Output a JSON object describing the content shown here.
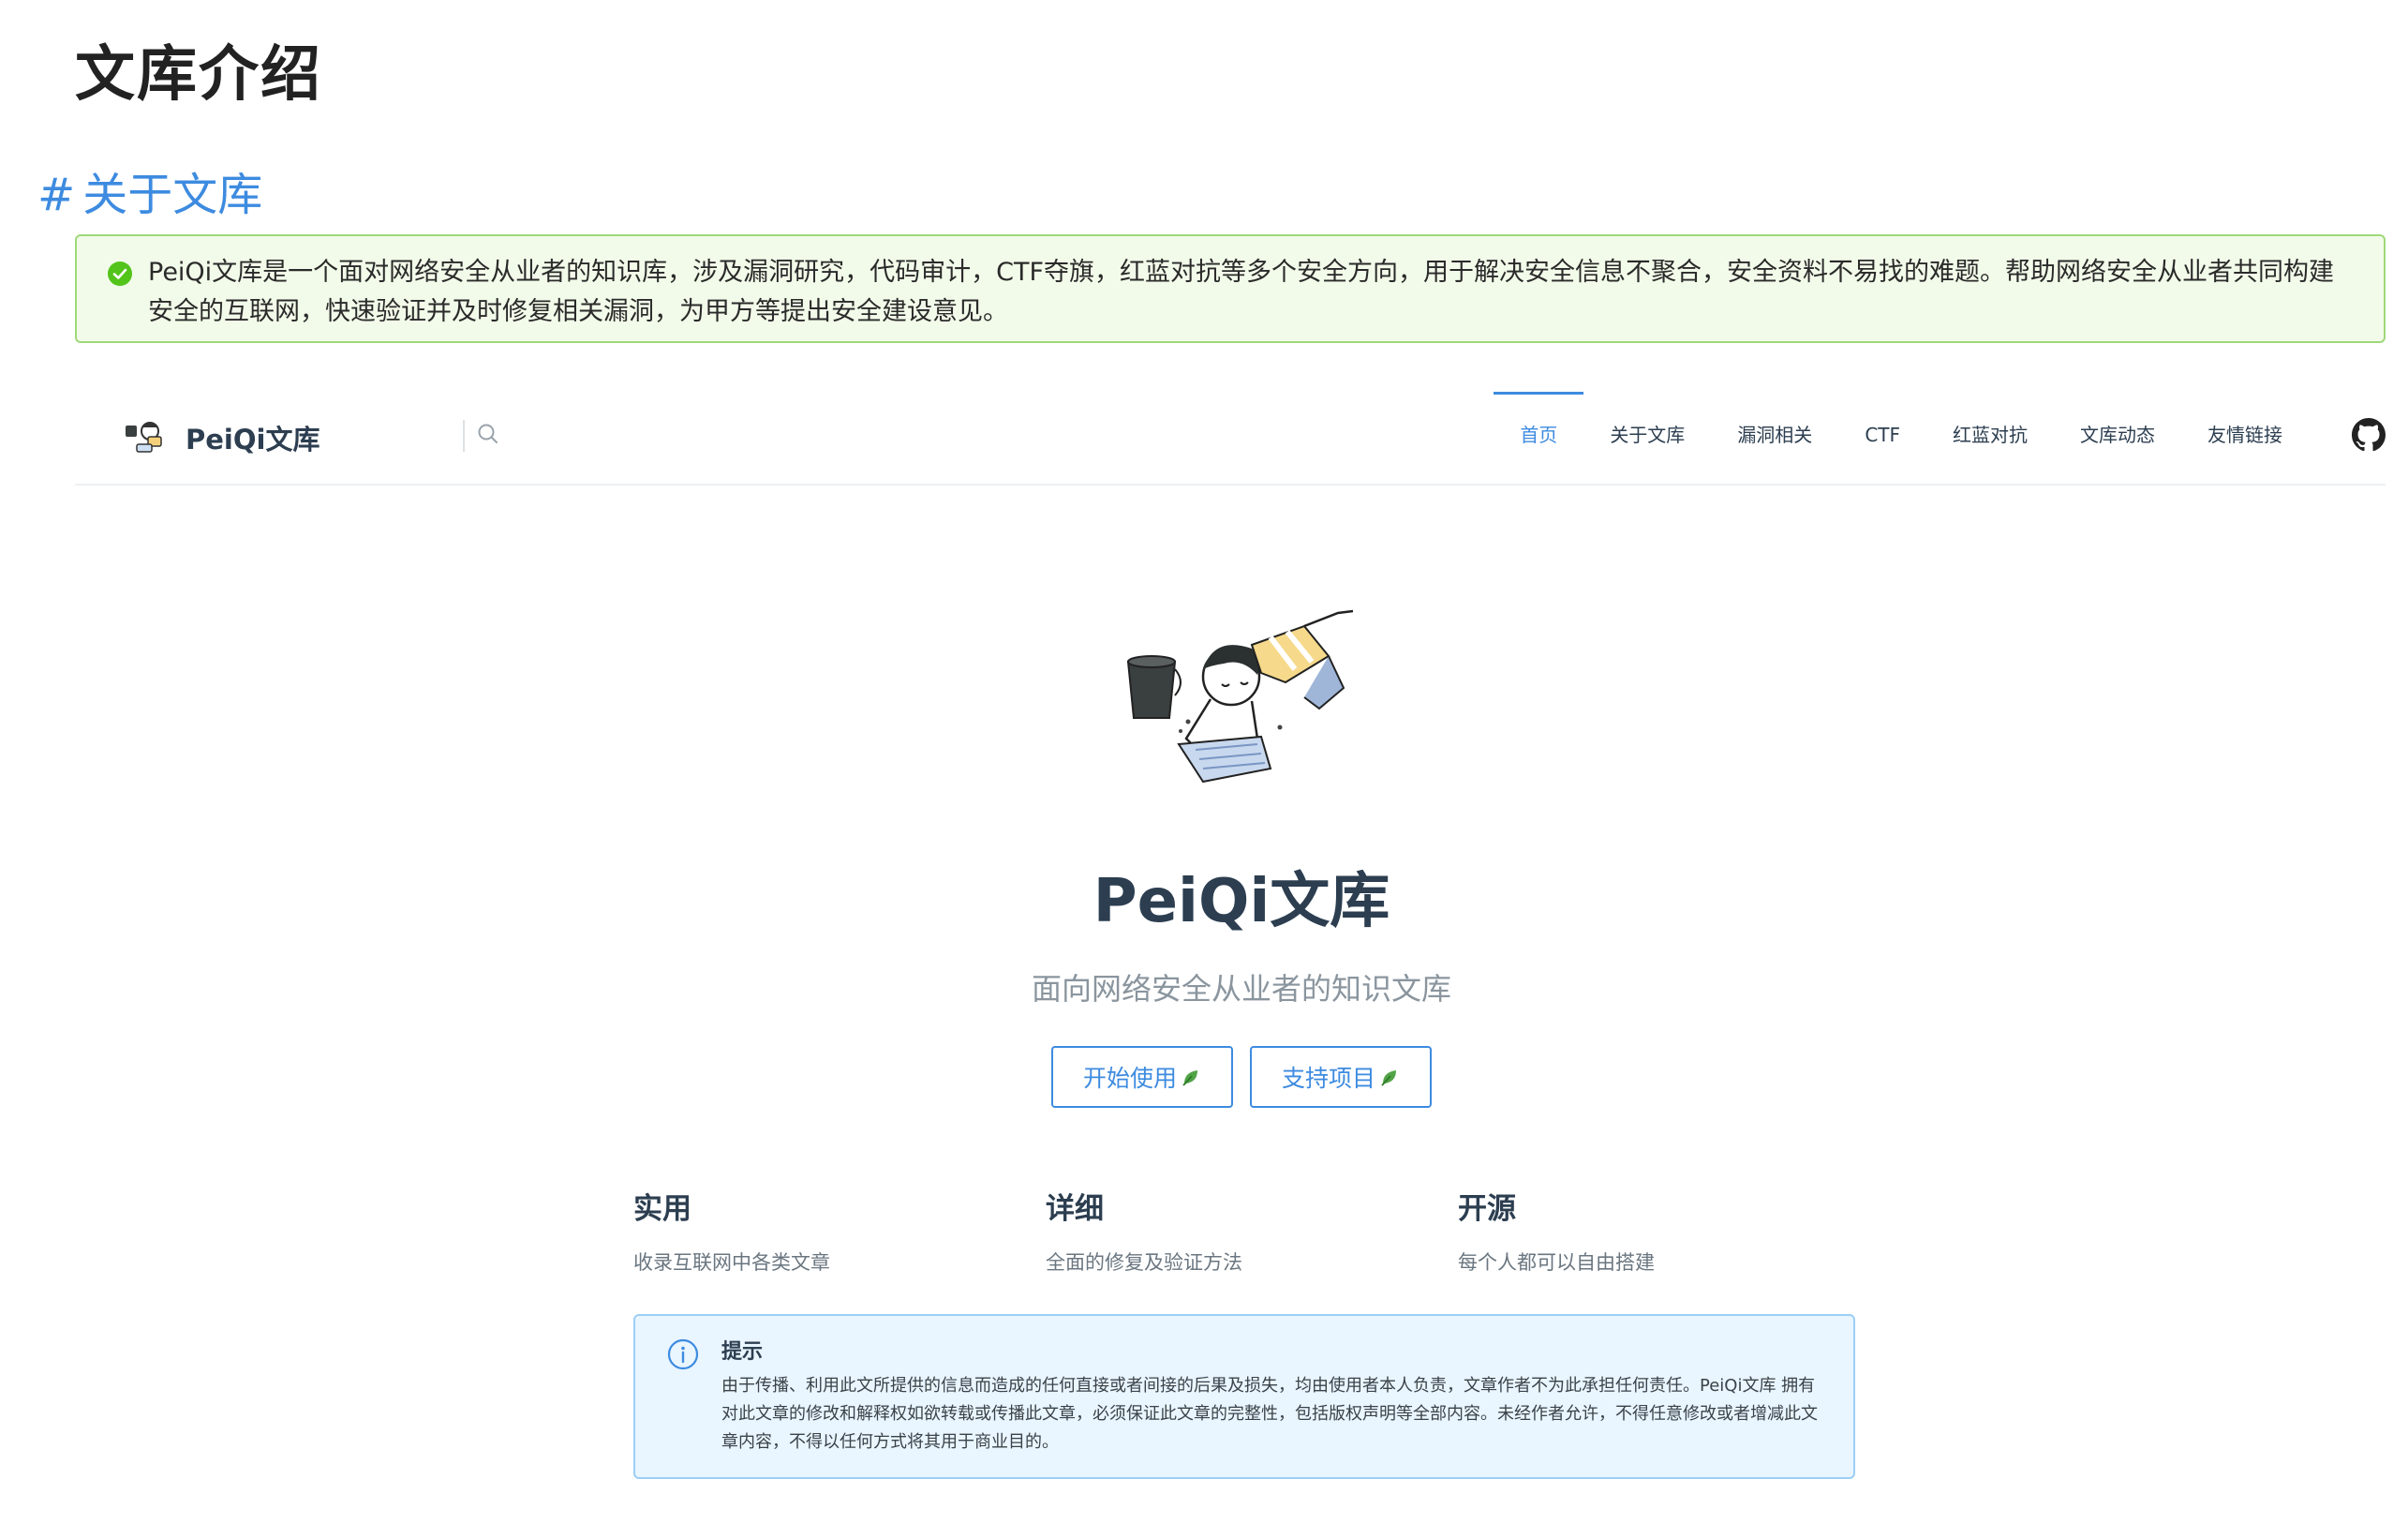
{
  "doc": {
    "title": "文库介绍",
    "section": {
      "hash": "#",
      "heading": "关于文库"
    },
    "intro": "PeiQi文库是一个面对网络安全从业者的知识库，涉及漏洞研究，代码审计，CTF夺旗，红蓝对抗等多个安全方向，用于解决安全信息不聚合，安全资料不易找的难题。帮助网络安全从业者共同构建安全的互联网，快速验证并及时修复相关漏洞，为甲方等提出安全建设意见。"
  },
  "site": {
    "brand": "PeiQi文库",
    "nav": [
      {
        "label": "首页",
        "active": true
      },
      {
        "label": "关于文库"
      },
      {
        "label": "漏洞相关"
      },
      {
        "label": "CTF"
      },
      {
        "label": "红蓝对抗"
      },
      {
        "label": "文库动态"
      },
      {
        "label": "友情链接"
      }
    ],
    "hero": {
      "title": "PeiQi文库",
      "subtitle": "面向网络安全从业者的知识文库",
      "actions": [
        {
          "label": "开始使用"
        },
        {
          "label": "支持项目"
        }
      ]
    },
    "features": [
      {
        "title": "实用",
        "desc": "收录互联网中各类文章"
      },
      {
        "title": "详细",
        "desc": "全面的修复及验证方法"
      },
      {
        "title": "开源",
        "desc": "每个人都可以自由搭建"
      }
    ],
    "tip": {
      "title": "提示",
      "content": "由于传播、利用此文所提供的信息而造成的任何直接或者间接的后果及损失，均由使用者本人负责，文章作者不为此承担任何责任。PeiQi文库 拥有对此文章的修改和解释权如欲转载或传播此文章，必须保证此文章的完整性，包括版权声明等全部内容。未经作者允许，不得任意修改或者增减此文章内容，不得以任何方式将其用于商业目的。"
    }
  },
  "colors": {
    "accent": "#3d8be0",
    "success_bg": "#f2fbe9",
    "success_border": "#9fd97a",
    "tip_bg": "#e9f5ff"
  },
  "icons": [
    "check-circle-icon",
    "search-icon",
    "github-icon",
    "leaf-icon",
    "info-icon"
  ]
}
